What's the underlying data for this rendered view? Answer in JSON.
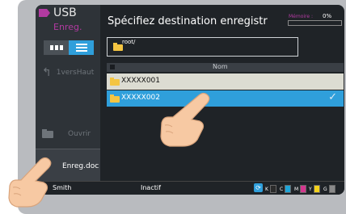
{
  "sidebar": {
    "app_title": "USB",
    "app_subtitle": "Enreg.",
    "up_label": "1versHaut",
    "open_label": "Ouvrir",
    "save_label": "Enreg.doc"
  },
  "header": {
    "title": "Spécifiez destination enregistr",
    "memory_label": "Mémoire :",
    "memory_value": "0%",
    "memory_fraction": 0
  },
  "path": {
    "value": "root/"
  },
  "list": {
    "column_header": "Nom",
    "items": [
      {
        "label": "XXXXX001",
        "selected": false
      },
      {
        "label": "XXXXX002",
        "selected": true
      }
    ]
  },
  "status": {
    "user": "Smith",
    "state": "Inactif",
    "toner": [
      {
        "letter": "K",
        "color": "#2b2b2b"
      },
      {
        "letter": "C",
        "color": "#1fa5d8"
      },
      {
        "letter": "M",
        "color": "#d4378e"
      },
      {
        "letter": "Y",
        "color": "#f3d11c"
      },
      {
        "letter": "G",
        "color": "#8a8a8a"
      }
    ]
  },
  "colors": {
    "accent": "#2f9fdb",
    "brand_magenta": "#b23aa1",
    "folder": "#f4c542"
  },
  "icons": [
    "usb-icon",
    "grid-view-icon",
    "list-view-icon",
    "up-arrow-icon",
    "folder-icon",
    "check-icon",
    "refresh-icon",
    "hand-pointer-icon"
  ]
}
